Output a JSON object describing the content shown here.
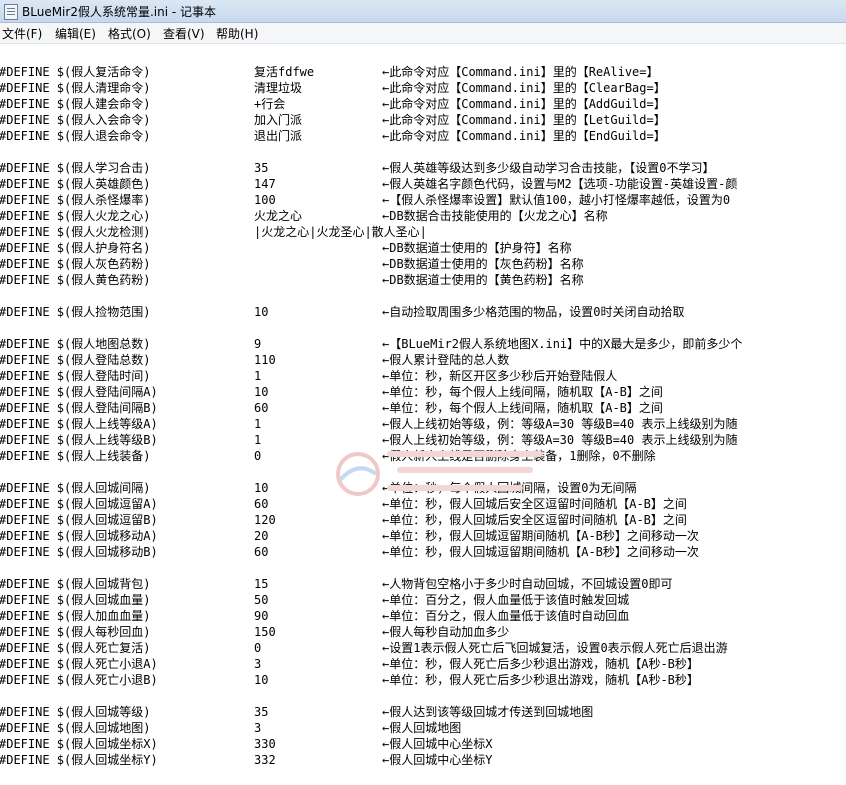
{
  "window": {
    "title": "BLueMir2假人系统常量.ini - 记事本"
  },
  "menu": [
    "文件(F)",
    "编辑(E)",
    "格式(O)",
    "查看(V)",
    "帮助(H)"
  ],
  "lines": [
    [
      "#DEFINE $(假人复活命令)",
      "复活fdfwe",
      "←此命令对应【Command.ini】里的【ReAlive=】"
    ],
    [
      "#DEFINE $(假人清理命令)",
      "清理垃圾",
      "←此命令对应【Command.ini】里的【ClearBag=】"
    ],
    [
      "#DEFINE $(假人建会命令)",
      "+行会",
      "←此命令对应【Command.ini】里的【AddGuild=】"
    ],
    [
      "#DEFINE $(假人入会命令)",
      "加入门派",
      "←此命令对应【Command.ini】里的【LetGuild=】"
    ],
    [
      "#DEFINE $(假人退会命令)",
      "退出门派",
      "←此命令对应【Command.ini】里的【EndGuild=】"
    ],
    [
      "",
      "",
      ""
    ],
    [
      "#DEFINE $(假人学习合击)",
      "35",
      "←假人英雄等级达到多少级自动学习合击技能，【设置0不学习】"
    ],
    [
      "#DEFINE $(假人英雄颜色)",
      "147",
      "←假人英雄名字颜色代码，设置与M2【选项-功能设置-英雄设置-颜"
    ],
    [
      "#DEFINE $(假人杀怪爆率)",
      "100",
      "←【假人杀怪爆率设置】默认值100，越小打怪爆率越低，设置为0"
    ],
    [
      "#DEFINE $(假人火龙之心)",
      "火龙之心",
      "←DB数据合击技能使用的【火龙之心】名称"
    ],
    [
      "#DEFINE $(假人火龙检测)",
      "|火龙之心|火龙圣心|散人圣心|",
      ""
    ],
    [
      "#DEFINE $(假人护身符名)",
      "",
      "←DB数据道士使用的【护身符】名称"
    ],
    [
      "#DEFINE $(假人灰色药粉)",
      "",
      "←DB数据道士使用的【灰色药粉】名称"
    ],
    [
      "#DEFINE $(假人黄色药粉)",
      "",
      "←DB数据道士使用的【黄色药粉】名称"
    ],
    [
      "",
      "",
      ""
    ],
    [
      "#DEFINE $(假人捡物范围)",
      "10",
      "←自动捡取周围多少格范围的物品，设置0时关闭自动拾取"
    ],
    [
      "",
      "",
      ""
    ],
    [
      "#DEFINE $(假人地图总数)",
      "9",
      "←【BLueMir2假人系统地图X.ini】中的X最大是多少，即前多少个"
    ],
    [
      "#DEFINE $(假人登陆总数)",
      "110",
      "←假人累计登陆的总人数"
    ],
    [
      "#DEFINE $(假人登陆时间)",
      "1",
      "←单位：秒，新区开区多少秒后开始登陆假人"
    ],
    [
      "#DEFINE $(假人登陆间隔A)",
      "10",
      "←单位：秒，每个假人上线间隔，随机取【A-B】之间"
    ],
    [
      "#DEFINE $(假人登陆间隔B)",
      "60",
      "←单位：秒，每个假人上线间隔，随机取【A-B】之间"
    ],
    [
      "#DEFINE $(假人上线等级A)",
      "1",
      "←假人上线初始等级，例：等级A=30 等级B=40 表示上线级别为随"
    ],
    [
      "#DEFINE $(假人上线等级B)",
      "1",
      "←假人上线初始等级，例：等级A=30 等级B=40 表示上线级别为随"
    ],
    [
      "#DEFINE $(假人上线装备)",
      "0",
      "←假人新人上线是否删除身上装备，1删除，0不删除"
    ],
    [
      "",
      "",
      ""
    ],
    [
      "#DEFINE $(假人回城间隔)",
      "10",
      "←单位：秒，每个假人回城间隔，设置0为无间隔"
    ],
    [
      "#DEFINE $(假人回城逗留A)",
      "60",
      "←单位：秒，假人回城后安全区逗留时间随机【A-B】之间"
    ],
    [
      "#DEFINE $(假人回城逗留B)",
      "120",
      "←单位：秒，假人回城后安全区逗留时间随机【A-B】之间"
    ],
    [
      "#DEFINE $(假人回城移动A)",
      "20",
      "←单位：秒，假人回城逗留期间随机【A-B秒】之间移动一次"
    ],
    [
      "#DEFINE $(假人回城移动B)",
      "60",
      "←单位：秒，假人回城逗留期间随机【A-B秒】之间移动一次"
    ],
    [
      "",
      "",
      ""
    ],
    [
      "#DEFINE $(假人回城背包)",
      "15",
      "←人物背包空格小于多少时自动回城，不回城设置0即可"
    ],
    [
      "#DEFINE $(假人回城血量)",
      "50",
      "←单位：百分之，假人血量低于该值时触发回城"
    ],
    [
      "#DEFINE $(假人加血血量)",
      "90",
      "←单位：百分之，假人血量低于该值时自动回血"
    ],
    [
      "#DEFINE $(假人每秒回血)",
      "150",
      "←假人每秒自动加血多少"
    ],
    [
      "#DEFINE $(假人死亡复活)",
      "0",
      "←设置1表示假人死亡后飞回城复活，设置0表示假人死亡后退出游"
    ],
    [
      "#DEFINE $(假人死亡小退A)",
      "3",
      "←单位：秒，假人死亡后多少秒退出游戏，随机【A秒-B秒】"
    ],
    [
      "#DEFINE $(假人死亡小退B)",
      "10",
      "←单位：秒，假人死亡后多少秒退出游戏，随机【A秒-B秒】"
    ],
    [
      "",
      "",
      ""
    ],
    [
      "#DEFINE $(假人回城等级)",
      "35",
      "←假人达到该等级回城才传送到回城地图"
    ],
    [
      "#DEFINE $(假人回城地图)",
      "3",
      "←假人回城地图"
    ],
    [
      "#DEFINE $(假人回城坐标X)",
      "330",
      "←假人回城中心坐标X"
    ],
    [
      "#DEFINE $(假人回城坐标Y)",
      "332",
      "←假人回城中心坐标Y"
    ]
  ]
}
